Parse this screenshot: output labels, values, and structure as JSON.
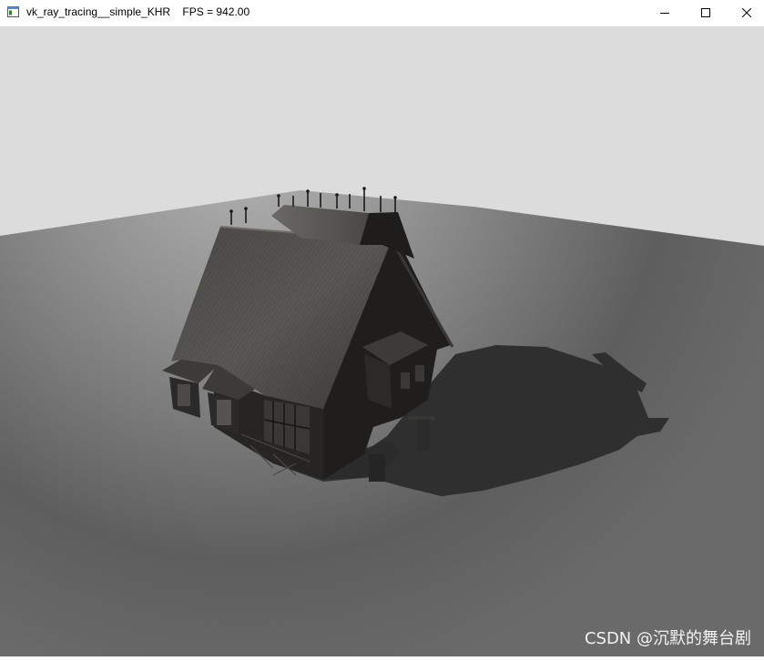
{
  "window": {
    "title": "vk_ray_tracing__simple_KHR    FPS = 942.00",
    "icon": "app-window-icon",
    "controls": {
      "minimize": "minimize-icon",
      "maximize": "maximize-icon",
      "close": "close-icon"
    }
  },
  "scene": {
    "sky_color": "#dcdcdc",
    "floor_color_light": "#a8a8a8",
    "floor_color_dark": "#4a4a4a",
    "shadow_color": "#2e2e2e",
    "model": "medieval-house"
  },
  "watermark": {
    "text": "CSDN @沉默的舞台剧"
  }
}
